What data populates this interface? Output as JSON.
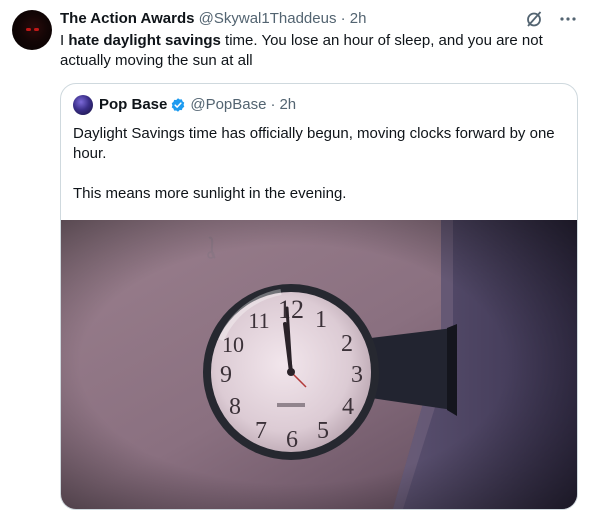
{
  "tweet": {
    "author_name": "The Action Awards",
    "author_handle": "@Skywal1Thaddeus",
    "separator": "·",
    "time": "2h",
    "text_before": "I ",
    "text_bold": "hate daylight savings",
    "text_after": " time. You lose an hour of sleep, and you are not actually moving the sun at all"
  },
  "quoted": {
    "author_name": "Pop Base",
    "author_handle": "@PopBase",
    "separator": "·",
    "time": "2h",
    "paragraph1": "Daylight Savings time has officially begun, moving clocks forward by one hour.",
    "paragraph2": "This means more sunlight in the evening."
  },
  "clock_numbers": [
    "12",
    "1",
    "2",
    "3",
    "4",
    "5",
    "6",
    "7",
    "8",
    "9",
    "10",
    "11"
  ],
  "colors": {
    "verified": "#1d9bf0",
    "muted": "#536471",
    "border": "#cfd9de"
  },
  "icons": [
    "avatar",
    "slash-circle-icon",
    "more-icon",
    "verified-icon"
  ]
}
